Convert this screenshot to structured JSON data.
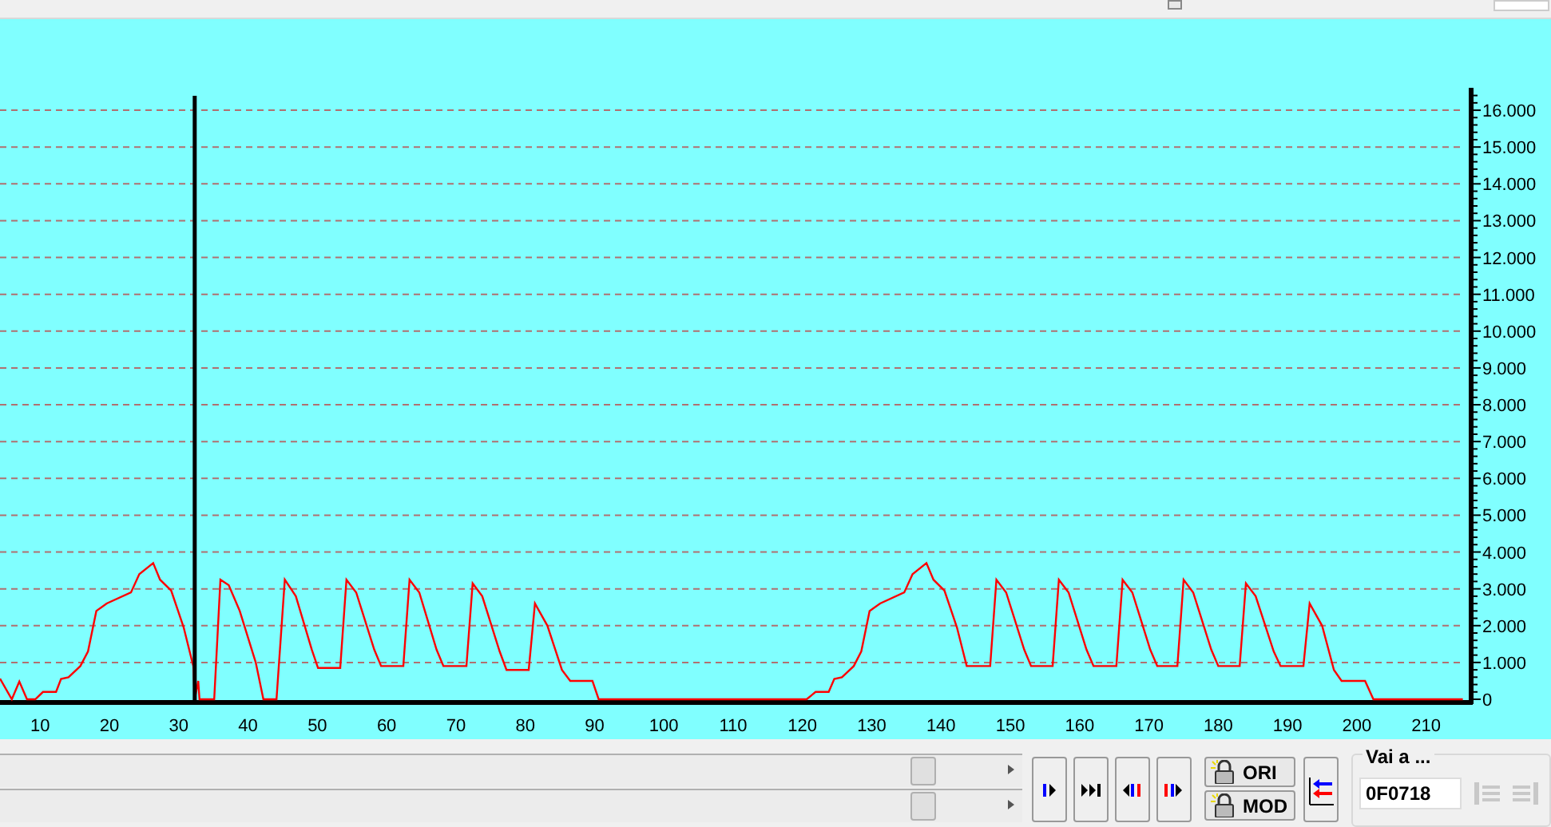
{
  "chart_data": {
    "type": "line",
    "x": [
      4.2,
      5.9,
      7.0,
      8.1,
      9.3,
      10.4,
      12.3,
      13.0,
      14.1,
      15.8,
      16.9,
      18.1,
      19.6,
      23.1,
      24.3,
      26.3,
      27.3,
      28.9,
      30.7,
      32.1,
      32.3,
      32.8,
      33.0,
      35.1,
      36.0,
      37.2,
      38.8,
      41.1,
      42.2,
      44.1,
      45.3,
      46.9,
      49.2,
      50.1,
      53.3,
      54.2,
      55.6,
      58.2,
      59.2,
      62.4,
      63.3,
      64.7,
      67.2,
      68.2,
      71.5,
      72.4,
      73.8,
      76.3,
      77.3,
      80.5,
      81.4,
      83.2,
      85.3,
      86.5,
      89.7,
      90.6,
      120.6,
      121.9,
      123.8,
      124.6,
      125.7,
      127.4,
      128.5,
      129.7,
      131.2,
      134.7,
      135.9,
      137.9,
      138.9,
      140.5,
      142.3,
      143.7,
      147.1,
      148.0,
      149.4,
      152.0,
      153.0,
      156.1,
      157.0,
      158.4,
      161.0,
      162.0,
      165.3,
      166.2,
      167.6,
      170.2,
      171.2,
      174.1,
      175.0,
      176.4,
      179.0,
      180.0,
      183.1,
      184.0,
      185.4,
      188.0,
      189.0,
      192.3,
      193.2,
      195.0,
      196.7,
      197.8,
      201.2,
      202.4,
      215.3
    ],
    "series": [
      {
        "color": "#ff0000",
        "values": [
          560,
          0,
          480,
          0,
          0,
          200,
          200,
          550,
          600,
          900,
          1300,
          2400,
          2600,
          2900,
          3400,
          3700,
          3250,
          2950,
          1950,
          900,
          0,
          500,
          0,
          0,
          3250,
          3100,
          2400,
          1000,
          0,
          0,
          3250,
          2800,
          1350,
          850,
          850,
          3250,
          2900,
          1350,
          900,
          900,
          3250,
          2900,
          1350,
          900,
          900,
          3150,
          2800,
          1300,
          800,
          800,
          2600,
          2000,
          800,
          500,
          500,
          0,
          0,
          200,
          200,
          550,
          600,
          900,
          1300,
          2400,
          2600,
          2900,
          3400,
          3700,
          3250,
          2950,
          1950,
          900,
          900,
          3250,
          2900,
          1350,
          900,
          900,
          3250,
          2900,
          1350,
          900,
          900,
          3250,
          2900,
          1350,
          900,
          900,
          3250,
          2900,
          1350,
          900,
          900,
          3150,
          2800,
          1300,
          900,
          900,
          2600,
          2000,
          800,
          500,
          500,
          0,
          0
        ]
      }
    ],
    "xlim": [
      4.2,
      216.5
    ],
    "ylim": [
      0,
      16600
    ],
    "xticks": [
      10,
      20,
      30,
      40,
      50,
      60,
      70,
      80,
      90,
      100,
      110,
      120,
      130,
      140,
      150,
      160,
      170,
      180,
      190,
      200,
      210
    ],
    "yticks": [
      {
        "value": 0,
        "label": "0"
      },
      {
        "value": 1000,
        "label": "1.000"
      },
      {
        "value": 2000,
        "label": "2.000"
      },
      {
        "value": 3000,
        "label": "3.000"
      },
      {
        "value": 4000,
        "label": "4.000"
      },
      {
        "value": 5000,
        "label": "5.000"
      },
      {
        "value": 6000,
        "label": "6.000"
      },
      {
        "value": 7000,
        "label": "7.000"
      },
      {
        "value": 8000,
        "label": "8.000"
      },
      {
        "value": 9000,
        "label": "9.000"
      },
      {
        "value": 10000,
        "label": "10.000"
      },
      {
        "value": 11000,
        "label": "11.000"
      },
      {
        "value": 12000,
        "label": "12.000"
      },
      {
        "value": 13000,
        "label": "13.000"
      },
      {
        "value": 14000,
        "label": "14.000"
      },
      {
        "value": 15000,
        "label": "15.000"
      },
      {
        "value": 16000,
        "label": "16.000"
      }
    ],
    "grid": true,
    "ref_lines": [
      {
        "axis": "x",
        "value": 32.3,
        "color": "#000000"
      }
    ]
  },
  "nav_buttons": [
    {
      "kind": "step"
    },
    {
      "kind": "end"
    },
    {
      "kind": "back"
    },
    {
      "kind": "forward"
    }
  ],
  "lock_buttons": [
    {
      "label": "ORI"
    },
    {
      "label": "MOD"
    }
  ],
  "goto": {
    "label": "Vai a ...",
    "value": "0F0718"
  }
}
